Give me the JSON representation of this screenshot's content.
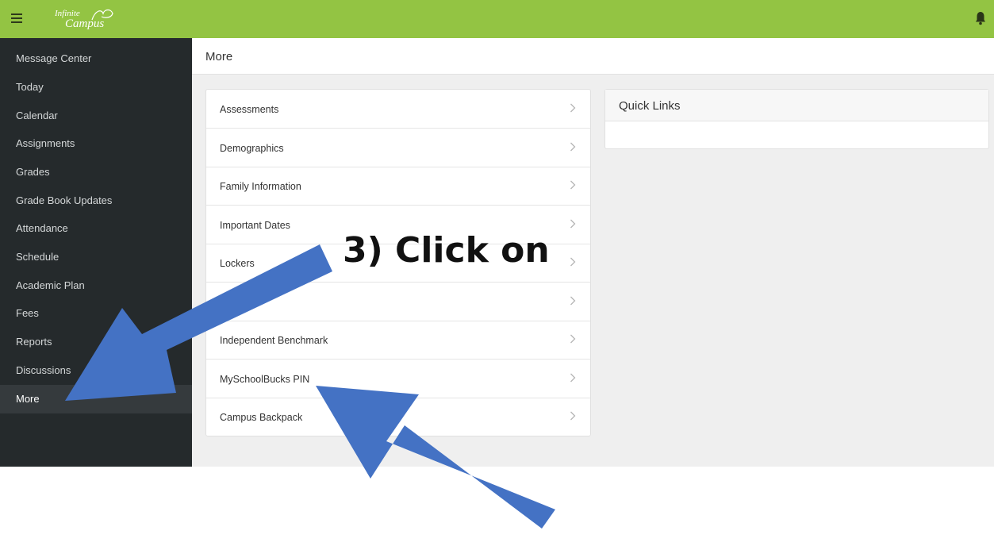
{
  "header": {
    "logo_line1": "Infinite",
    "logo_line2": "Campus",
    "menu_icon": "hamburger-menu-icon",
    "notification_icon": "bell-icon",
    "brand_color": "#93c443"
  },
  "sidebar": {
    "background": "#252a2c",
    "items": [
      {
        "label": "Message Center"
      },
      {
        "label": "Today"
      },
      {
        "label": "Calendar"
      },
      {
        "label": "Assignments"
      },
      {
        "label": "Grades"
      },
      {
        "label": "Grade Book Updates"
      },
      {
        "label": "Attendance"
      },
      {
        "label": "Schedule"
      },
      {
        "label": "Academic Plan"
      },
      {
        "label": "Fees"
      },
      {
        "label": "Reports"
      },
      {
        "label": "Discussions"
      },
      {
        "label": "More",
        "active": true
      }
    ]
  },
  "page": {
    "title": "More"
  },
  "more_list": {
    "chevron_icon": "chevron-right-icon",
    "items": [
      {
        "label": "Assessments"
      },
      {
        "label": "Demographics"
      },
      {
        "label": "Family Information"
      },
      {
        "label": "Important Dates"
      },
      {
        "label": "Lockers"
      },
      {
        "label": ""
      },
      {
        "label": "Independent Benchmark"
      },
      {
        "label": "MySchoolBucks PIN"
      },
      {
        "label": "Campus Backpack"
      }
    ]
  },
  "quick_links": {
    "title": "Quick Links"
  },
  "annotation": {
    "text": "3) Click on",
    "arrow_color": "#4472c4"
  }
}
